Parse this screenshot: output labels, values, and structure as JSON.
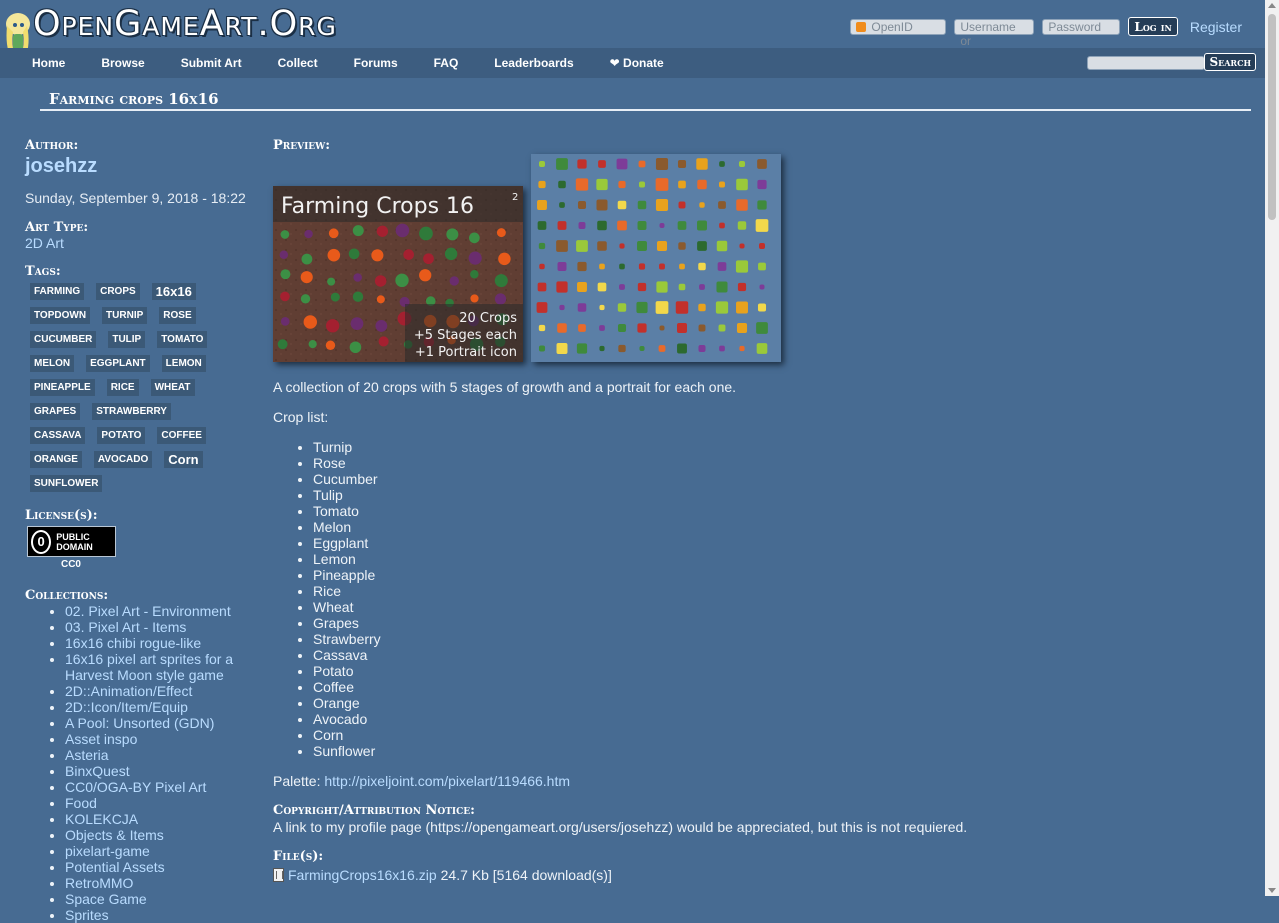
{
  "header": {
    "site_title": "OpenGameArt.Org",
    "openid_placeholder": "OpenID",
    "username_placeholder": "Username or",
    "password_placeholder": "Password",
    "login_label": "Log in",
    "register_label": "Register"
  },
  "nav": {
    "items": [
      "Home",
      "Browse",
      "Submit Art",
      "Collect",
      "Forums",
      "FAQ",
      "Leaderboards",
      "❤ Donate"
    ],
    "search_label": "Search"
  },
  "page": {
    "title": "Farming crops 16x16"
  },
  "sidebar": {
    "author_label": "Author:",
    "author": "josehzz",
    "date": "Sunday, September 9, 2018 - 18:22",
    "art_type_label": "Art Type:",
    "art_type": "2D Art",
    "tags_label": "Tags:",
    "tags": [
      "farming",
      "crops",
      "16x16",
      "topdown",
      "turnip",
      "rose",
      "cucumber",
      "tulip",
      "tomato",
      "melon",
      "eggplant",
      "lemon",
      "pineapple",
      "rice",
      "wheat",
      "grapes",
      "strawberry",
      "cassava",
      "potato",
      "coffee",
      "orange",
      "avocado",
      "Corn",
      "sunflower"
    ],
    "license_label": "License(s):",
    "license_badge": "PUBLIC DOMAIN",
    "license_name": "CC0",
    "collections_label": "Collections:",
    "collections": [
      "02. Pixel Art - Environment",
      "03. Pixel Art - Items",
      "16x16 chibi rogue-like",
      "16x16 pixel art sprites for a Harvest Moon style game",
      "2D::Animation/Effect",
      "2D::Icon/Item/Equip",
      "A Pool: Unsorted (GDN)",
      "Asset inspo",
      "Asteria",
      "BinxQuest",
      "CC0/OGA-BY Pixel Art",
      "Food",
      "KOLEKCJA",
      "Objects & Items",
      "pixelart-game",
      "Potential Assets",
      "RetroMMO",
      "Space Game",
      "Sprites"
    ]
  },
  "main": {
    "preview_label": "Preview:",
    "preview_title": "Farming Crops 16",
    "preview_sup": "2",
    "preview_caption": [
      "20 Crops",
      "+5 Stages each",
      "+1 Portrait icon"
    ],
    "description": "A collection of 20 crops with 5 stages of growth and a portrait for each one.",
    "crop_list_label": "Crop list:",
    "crops": [
      "Turnip",
      "Rose",
      "Cucumber",
      "Tulip",
      "Tomato",
      "Melon",
      "Eggplant",
      "Lemon",
      "Pineapple",
      "Rice",
      "Wheat",
      "Grapes",
      "Strawberry",
      "Cassava",
      "Potato",
      "Coffee",
      "Orange",
      "Avocado",
      "Corn",
      "Sunflower"
    ],
    "palette_label": "Palette:",
    "palette_link": "http://pixeljoint.com/pixelart/119466.htm",
    "attr_label": "Copyright/Attribution Notice:",
    "attr_text": "A link to my profile page (https://opengameart.org/users/josehzz) would be appreciated, but this is not requiered.",
    "files_label": "File(s):",
    "file_name": "FarmingCrops16x16.zip",
    "file_info": "24.7 Kb [5164 download(s)]"
  }
}
